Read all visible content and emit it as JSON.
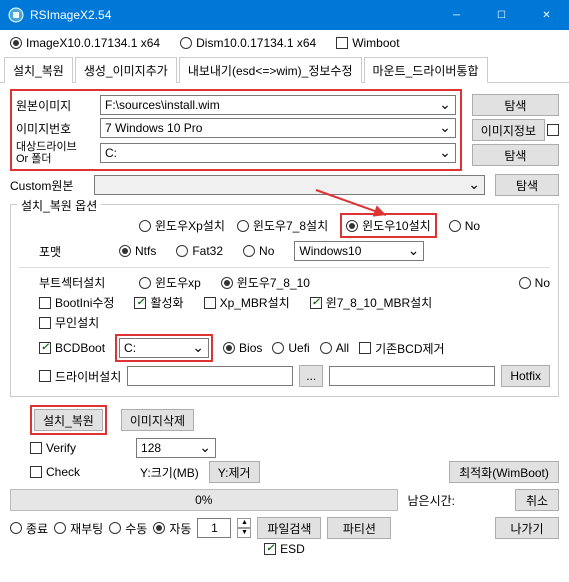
{
  "title": "RSImageX2.54",
  "top": {
    "r1": "ImageX10.0.17134.1 x64",
    "r2": "Dism10.0.17134.1 x64",
    "c1": "Wimboot"
  },
  "tabs": [
    "설치_복원",
    "생성_이미지추가",
    "내보내기(esd<=>wim)_정보수정",
    "마운트_드라이버통합"
  ],
  "src": {
    "l1": "원본이미지",
    "v1": "F:\\sources\\install.wim",
    "b1": "탐색",
    "l2": "이미지번호",
    "v2": "7  Windows 10 Pro",
    "b2": "이미지정보",
    "l3": "대상드라이브\nOr 폴더",
    "v3": "C:",
    "b3": "탐색"
  },
  "custom": {
    "l": "Custom원본",
    "b": "탐색"
  },
  "opt": {
    "legend": "설치_복원 옵션",
    "os": {
      "r1": "윈도우Xp설치",
      "r2": "윈도우7_8설치",
      "r3": "윈도우10설치",
      "r4": "No"
    },
    "fmt": {
      "l": "포맷",
      "r1": "Ntfs",
      "r2": "Fat32",
      "r3": "No",
      "combo": "Windows10"
    },
    "boot": {
      "l": "부트섹터설치",
      "r1": "윈도우xp",
      "r2": "윈도우7_8_10",
      "r3": "No"
    },
    "row2": {
      "c1": "BootIni수정",
      "c2": "활성화",
      "c3": "Xp_MBR설치",
      "c4": "윈7_8_10_MBR설치"
    },
    "row3": {
      "c1": "무인설치"
    },
    "row4": {
      "c1": "BCDBoot",
      "combo": "C:",
      "r1": "Bios",
      "r2": "Uefi",
      "r3": "All",
      "c2": "기존BCD제거"
    },
    "row5": {
      "c1": "드라이버설치",
      "browse": "...",
      "hotfix": "Hotfix"
    }
  },
  "act": {
    "b1": "설치_복원",
    "b2": "이미지삭제"
  },
  "ver": {
    "c1": "Verify",
    "c2": "Check",
    "combo": "128",
    "l2": "Y:크기(MB)",
    "b1": "Y:제거",
    "b2": "최적화(WimBoot)"
  },
  "prog": {
    "pct": "0%",
    "lbl": "남은시간:",
    "cancel": "취소"
  },
  "foot": {
    "r1": "종료",
    "r2": "재부팅",
    "r3": "수동",
    "r4": "자동",
    "spin": "1",
    "b1": "파일검색",
    "b2": "파티션",
    "b3": "나가기",
    "esd": "ESD"
  }
}
